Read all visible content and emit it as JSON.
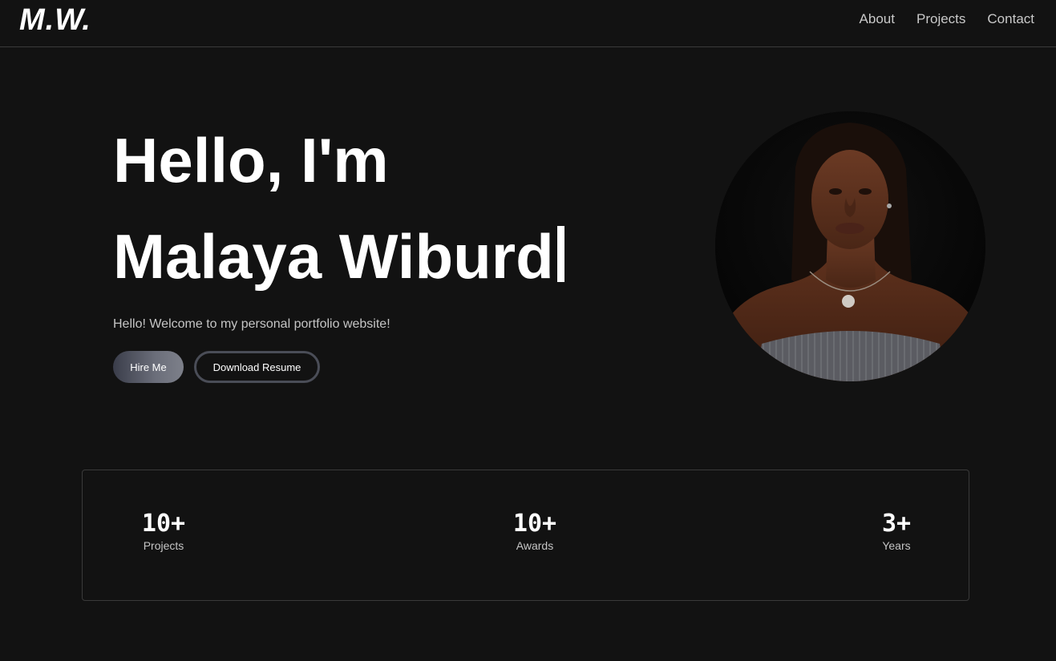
{
  "nav": {
    "logo": "M.W.",
    "links": [
      "About",
      "Projects",
      "Contact"
    ]
  },
  "hero": {
    "line1": "Hello, I'm",
    "line2": "Malaya Wiburd",
    "subtitle": "Hello! Welcome to my personal portfolio website!",
    "buttons": {
      "hire": "Hire Me",
      "resume": "Download Resume"
    }
  },
  "stats": [
    {
      "value": "10+",
      "label": "Projects"
    },
    {
      "value": "10+",
      "label": "Awards"
    },
    {
      "value": "3+",
      "label": "Years"
    }
  ],
  "colors": {
    "background": "#121212",
    "text": "#ffffff",
    "muted": "#c5c5c5",
    "border": "#3a3a3a"
  }
}
